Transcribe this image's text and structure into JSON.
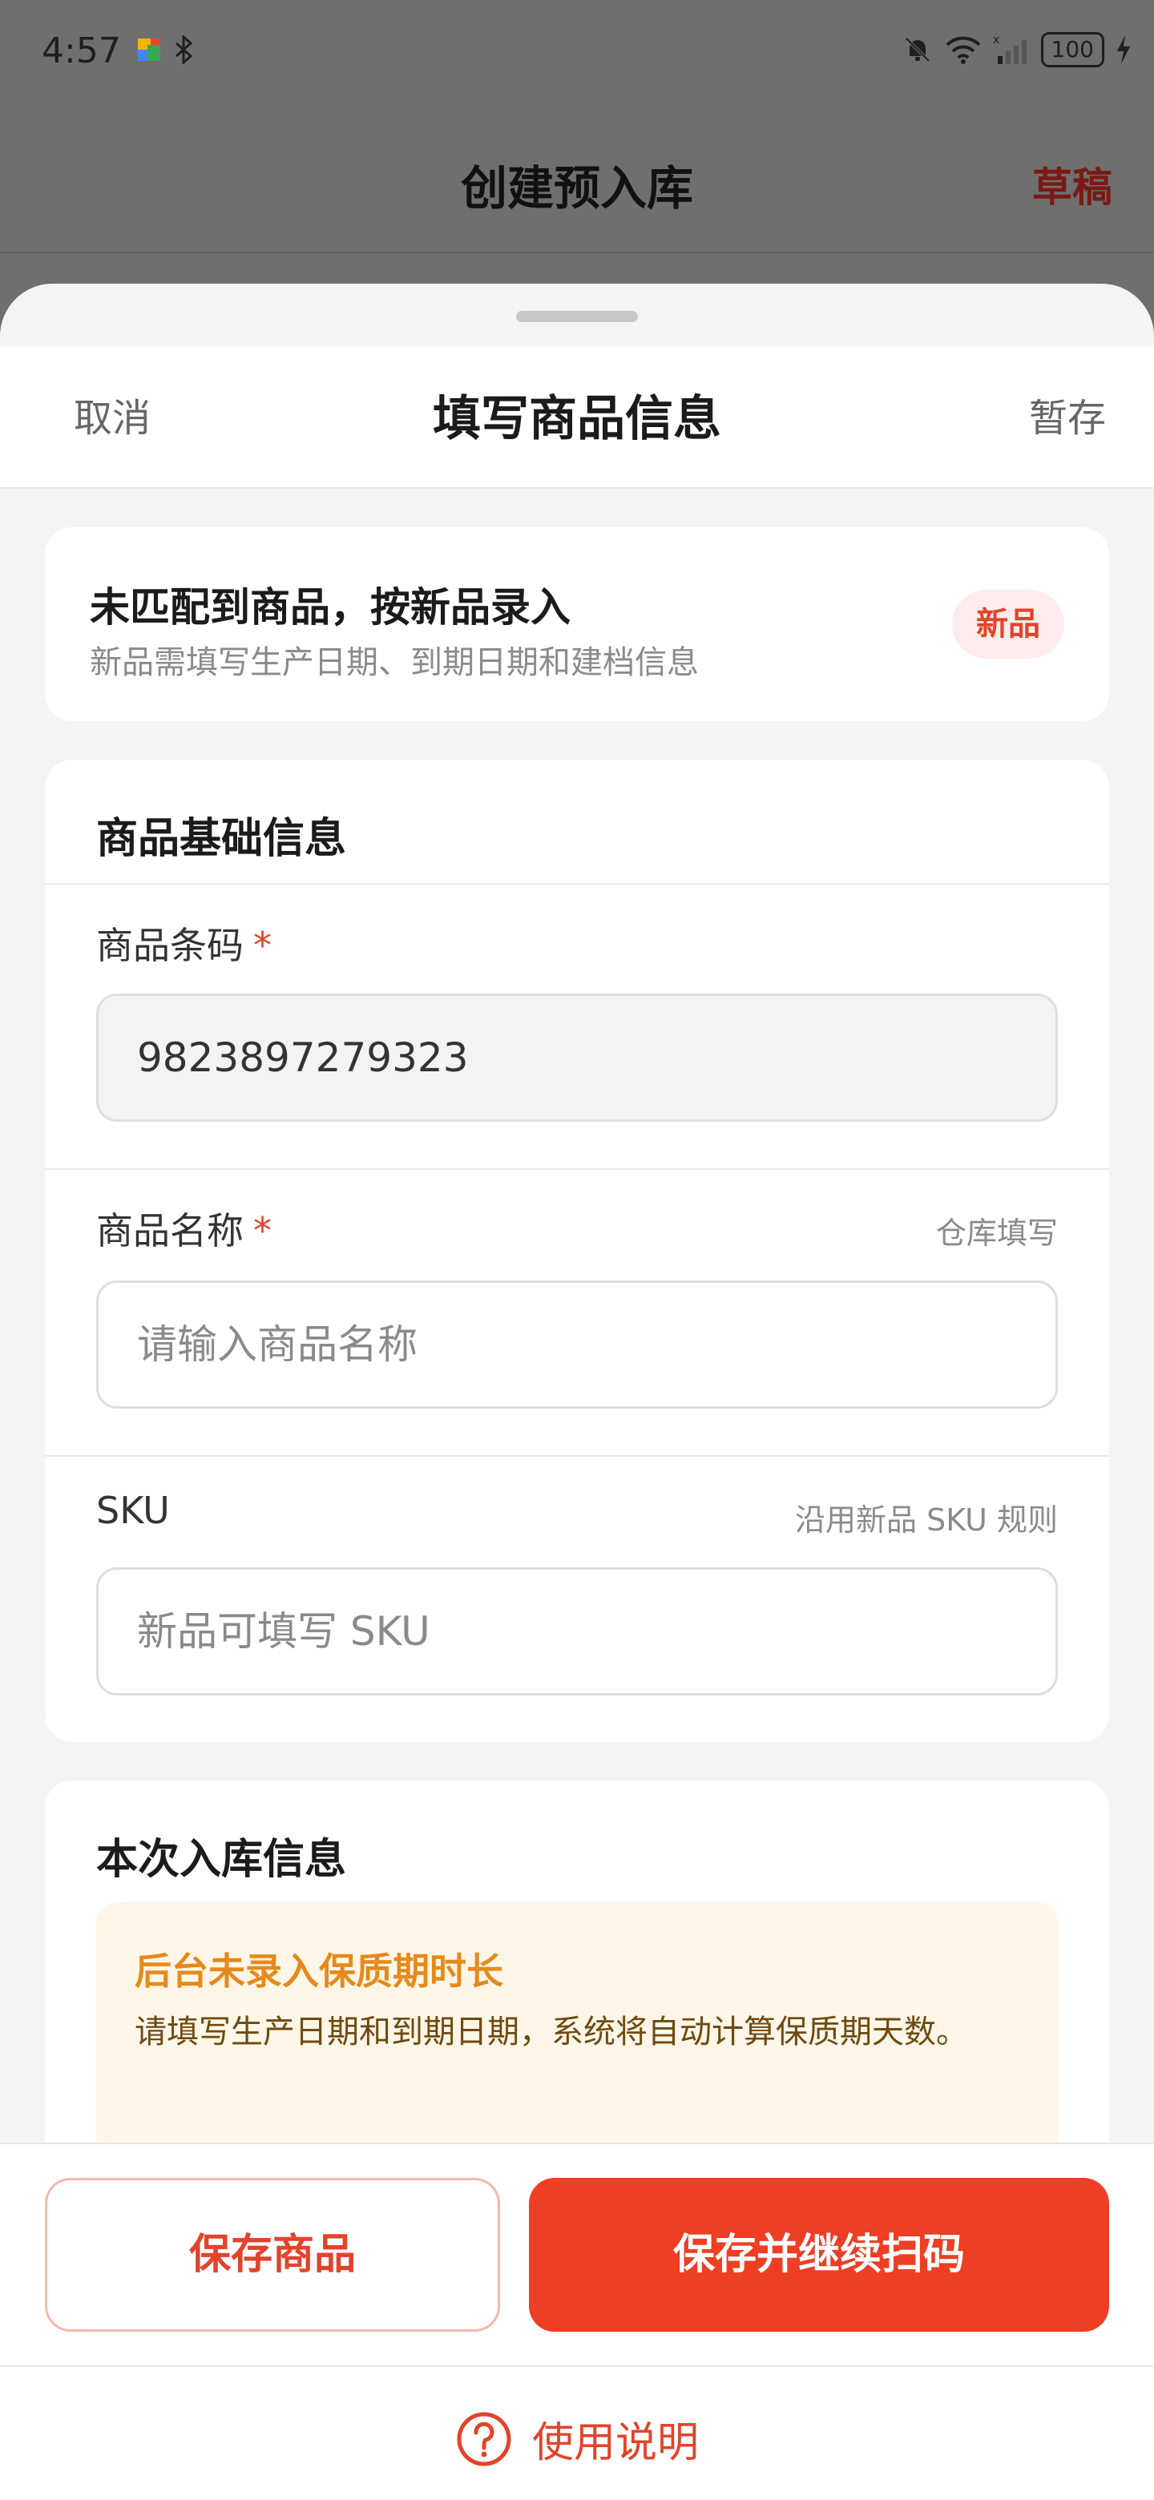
{
  "status_bar": {
    "time": "4:57",
    "battery": "100"
  },
  "page": {
    "title": "创建预入库",
    "draft_label": "草稿"
  },
  "sheet": {
    "cancel_label": "取消",
    "title": "填写商品信息",
    "save_temp_label": "暂存"
  },
  "notice": {
    "title": "未匹配到商品，按新品录入",
    "subtitle": "新品需填写生产日期、到期日期和建档信息",
    "badge": "新品"
  },
  "basic_info": {
    "section_title": "商品基础信息",
    "barcode": {
      "label": "商品条码",
      "required_mark": "*",
      "value": "9823897279323"
    },
    "name": {
      "label": "商品名称",
      "required_mark": "*",
      "hint": "仓库填写",
      "placeholder": "请输入商品名称"
    },
    "sku": {
      "label": "SKU",
      "hint": "沿用新品 SKU 规则",
      "placeholder": "新品可填写 SKU"
    }
  },
  "inbound_info": {
    "section_title": "本次入库信息",
    "warning_title": "后台未录入保质期时长",
    "warning_body": "请填写生产日期和到期日期，系统将自动计算保质期天数。"
  },
  "actions": {
    "save_label": "保存商品",
    "save_continue_label": "保存并继续扫码",
    "help_label": "使用说明"
  },
  "colors": {
    "accent": "#EE3E24",
    "warning": "#E58A1C",
    "background": "#F4F4F4"
  }
}
